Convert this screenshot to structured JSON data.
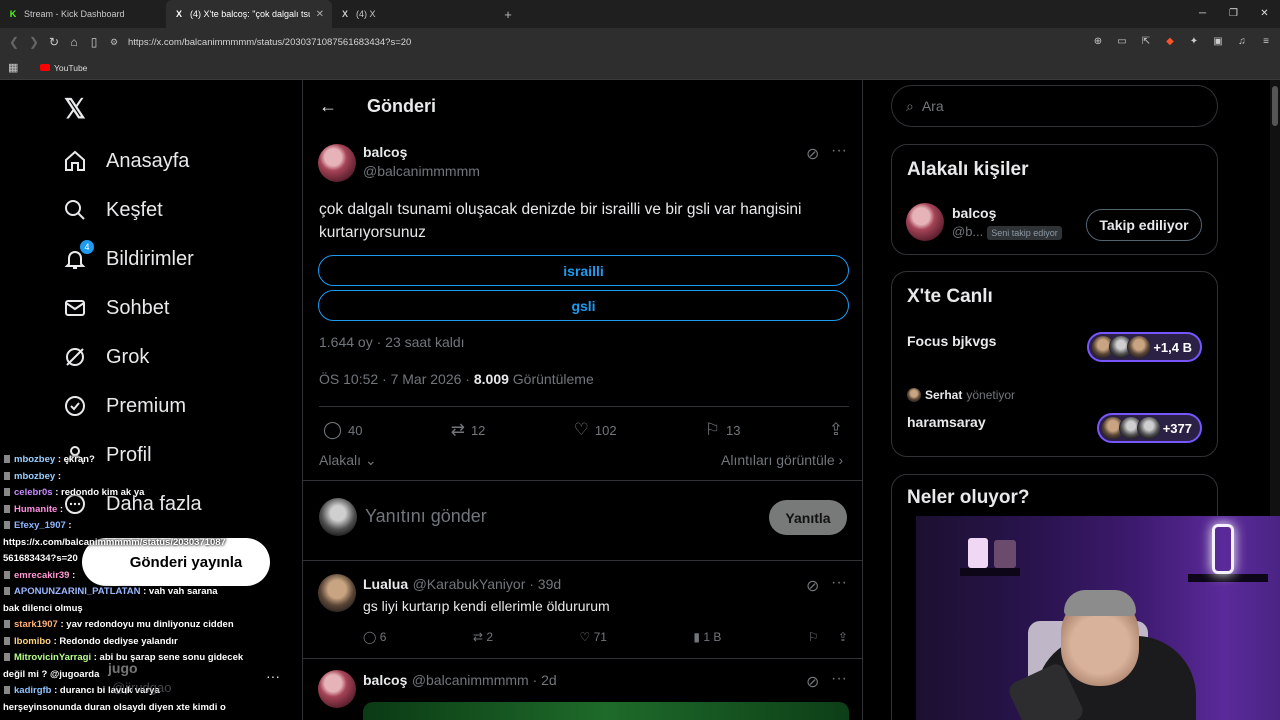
{
  "browser": {
    "tabs": [
      {
        "icon": "K",
        "label": "Stream - Kick Dashboard"
      },
      {
        "icon": "X",
        "label": "(4) X'te balcoş: \"çok dalgalı tsuna",
        "active": true
      },
      {
        "icon": "X",
        "label": "(4) X"
      }
    ],
    "new_tab": "+",
    "url": "https://x.com/balcanimmmmm/status/2030371087561683434?s=20",
    "bookmark": "YouTube"
  },
  "nav": {
    "items": [
      {
        "label": "Anasayfa"
      },
      {
        "label": "Keşfet"
      },
      {
        "label": "Bildirimler",
        "badge": "4"
      },
      {
        "label": "Sohbet"
      },
      {
        "label": "Grok"
      },
      {
        "label": "Premium"
      },
      {
        "label": "Profil"
      },
      {
        "label": "Daha fazla"
      }
    ]
  },
  "post": {
    "header_title": "Gönderi",
    "author_name": "balcoş",
    "author_handle": "@balcanimmmmm",
    "text": "çok dalgalı tsunami oluşacak denizde bir israilli ve bir gsli var hangisini kurtarıyorsunuz",
    "poll_options": [
      "israilli",
      "gsli"
    ],
    "poll_meta": "1.644 oy · 23 saat kaldı",
    "time": "ÖS 10:52 · 7 Mar 2026 · ",
    "views": "8.009",
    "views_label": " Görüntüleme",
    "replies": "40",
    "reposts": "12",
    "likes": "102",
    "bookmarks": "13",
    "relevant_label": "Alakalı",
    "quotes_label": "Alıntıları görüntüle"
  },
  "reply_box": {
    "placeholder": "Yanıtını gönder",
    "button": "Yanıtla"
  },
  "replies": [
    {
      "name": "Lualua",
      "handle": "@KarabukYaniyor · 39d",
      "text": "gs liyi kurtarıp kendi ellerimle öldururum",
      "replies": "6",
      "reposts": "2",
      "likes": "71",
      "views": "1 B"
    },
    {
      "name": "balcoş",
      "handle": "@balcanimmmmm · 2d"
    }
  ],
  "sidebar": {
    "search_placeholder": "Ara",
    "relevant_people_title": "Alakalı kişiler",
    "person_name": "balcoş",
    "person_handle": "@b...",
    "follows_you": "Seni takip ediyor",
    "follow_button": "Takip ediliyor",
    "live_title": "X'te Canlı",
    "live1_title": "Focus bjkvgs",
    "live1_count": "+1,4 B",
    "live2_host": "Serhat",
    "live2_host_suffix": " yönetiyor",
    "live2_title": "haramsaray",
    "live2_count": "+377",
    "trends_title": "Neler oluyor?"
  },
  "chat": {
    "bubble": "Gönderi yayınla",
    "lines": [
      {
        "user": "mbozbey",
        "color": "#9ad0ff",
        "msg": " : ekran?"
      },
      {
        "user": "mbozbey",
        "color": "#9ad0ff",
        "msg": " : "
      },
      {
        "user": "celebr0s",
        "color": "#c78bff",
        "msg": " : redondo kim ak ya"
      },
      {
        "user": "Humanite",
        "color": "#ff8de1",
        "msg": " : "
      },
      {
        "user": "Efexy_1907",
        "color": "#8fb8ff",
        "msg": " :"
      },
      {
        "user": "",
        "color": "#fff",
        "msg": "https://x.com/balcanimmmmm/status/2030371087"
      },
      {
        "user": "",
        "color": "#fff",
        "msg": "561683434?s=20"
      },
      {
        "user": "emrecakir39",
        "color": "#ff9ad4",
        "msg": " : "
      },
      {
        "user": "APONUNZARINI_PATLATAN",
        "color": "#9ab8ff",
        "msg": " : vah vah sarana"
      },
      {
        "user": "",
        "color": "#fff",
        "msg": "bak dilenci olmuş"
      },
      {
        "user": "stark1907",
        "color": "#ffb07a",
        "msg": " : yav redondoyu mu dinliyonuz cidden"
      },
      {
        "user": "lbomibo",
        "color": "#ffd27a",
        "msg": " : Redondo dediyse yalandır"
      },
      {
        "user": "MitrovicinYarragi",
        "color": "#b5ff8a",
        "msg": " : abi bu şarap sene sonu gidecek"
      },
      {
        "user": "",
        "color": "#fff",
        "msg": "değil mi ? @jugoarda"
      },
      {
        "user": "kadirgfb",
        "color": "#8fc4ff",
        "msg": " : durancı bi lavuk varya"
      },
      {
        "user": "",
        "color": "#fff",
        "msg": "herşeyinsonunda duran olsaydı diyen xte kimdi o"
      }
    ],
    "profile_name": "jugo",
    "profile_handle": "@jirudgao"
  }
}
